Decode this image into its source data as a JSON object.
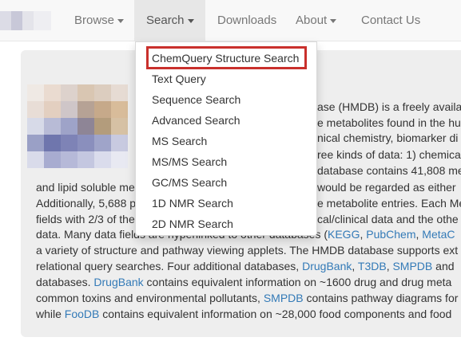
{
  "navbar": {
    "items": [
      {
        "label": "Browse",
        "dropdown": true
      },
      {
        "label": "Search",
        "dropdown": true,
        "active": true
      },
      {
        "label": "Downloads",
        "dropdown": false
      },
      {
        "label": "About",
        "dropdown": true
      },
      {
        "label": "Contact Us",
        "dropdown": false
      }
    ]
  },
  "search_menu": {
    "items": [
      "ChemQuery Structure Search",
      "Text Query",
      "Sequence Search",
      "Advanced Search",
      "MS Search",
      "MS/MS Search",
      "GC/MS Search",
      "1D NMR Search",
      "2D NMR Search"
    ],
    "highlighted_index": 0,
    "highlight_color": "#c9302c"
  },
  "intro": {
    "lines": [
      {
        "parts": [
          "ase (HMDB) is a freely availab"
        ]
      },
      {
        "parts": [
          "e metabolites found in the hu"
        ]
      },
      {
        "parts": [
          "nical chemistry, biomarker di"
        ]
      },
      {
        "parts": [
          "ree kinds of data: 1) chemica"
        ]
      },
      {
        "parts": [
          "database contains 41,808 me"
        ]
      },
      {
        "parts": [
          "and lipid soluble me",
          "would be regarded as either"
        ]
      },
      {
        "parts": [
          "Additionally, 5,688 p",
          "e metabolite entries. Each Me"
        ]
      },
      {
        "parts": [
          "fields with 2/3 of the",
          "cal/clinical data and the othe"
        ]
      },
      {
        "parts": [
          "data. Many data fields are hyperlinked to other databases (",
          "KEGG",
          ", ",
          "PubChem",
          ", ",
          "MetaC"
        ]
      },
      {
        "parts": [
          "a variety of structure and pathway viewing applets. The HMDB database supports ext"
        ]
      },
      {
        "parts": [
          "relational query searches. Four additional databases, ",
          "DrugBank",
          ", ",
          "T3DB",
          ", ",
          "SMPDB",
          " and"
        ]
      },
      {
        "parts": [
          "databases. ",
          "DrugBank",
          " contains equivalent information on ~1600 drug and drug meta"
        ]
      },
      {
        "parts": [
          "common toxins and environmental pollutants, ",
          "SMPDB",
          " contains pathway diagrams for"
        ]
      },
      {
        "parts": [
          "while ",
          "FooDB",
          " contains equivalent information on ~28,000 food components and food"
        ]
      }
    ]
  },
  "colors": {
    "link": "#337ab7",
    "navbar_bg": "#f8f8f8",
    "jumbotron_bg": "#eeeeee"
  }
}
